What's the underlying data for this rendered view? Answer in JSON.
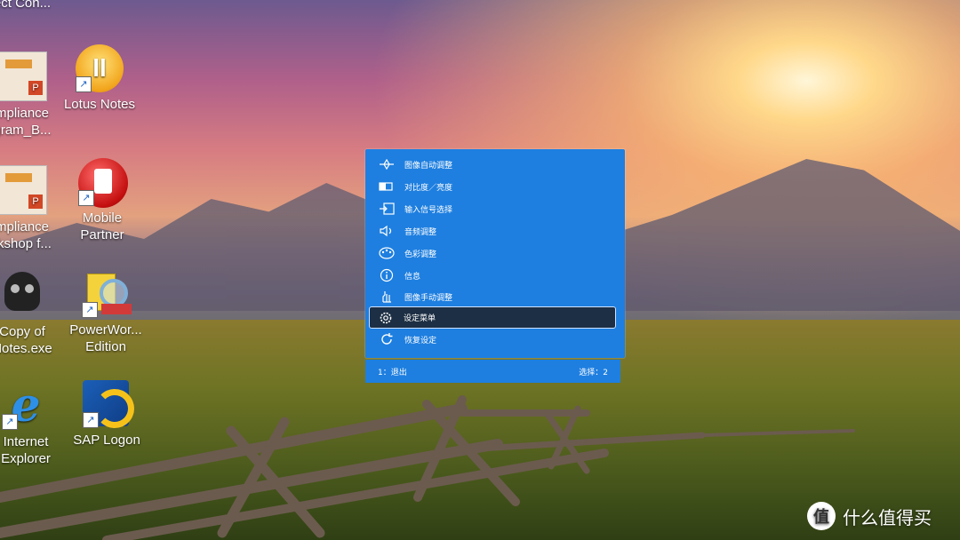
{
  "desktop": {
    "icons": [
      {
        "label": "ect Con...",
        "icon": "remote-desktop-icon"
      },
      {
        "label": "mpliance\ngram_B...",
        "icon": "powerpoint-file-icon"
      },
      {
        "label": "Lotus Notes",
        "icon": "lotus-notes-icon"
      },
      {
        "label": "mpliance\nrkshop f...",
        "icon": "powerpoint-file-icon"
      },
      {
        "label": "Mobile\nPartner",
        "icon": "mobile-partner-icon"
      },
      {
        "label": "Copy of\nNotes.exe",
        "icon": "skull-icon"
      },
      {
        "label": "PowerWor...\nEdition",
        "icon": "powerword-icon"
      },
      {
        "label": "Internet\nExplorer",
        "icon": "internet-explorer-icon"
      },
      {
        "label": "SAP Logon",
        "icon": "sap-logon-icon"
      }
    ]
  },
  "osd": {
    "menu": [
      {
        "label": "图像自动调整",
        "icon": "auto-adjust-icon"
      },
      {
        "label": "对比度／亮度",
        "icon": "contrast-brightness-icon"
      },
      {
        "label": "输入信号选择",
        "icon": "input-source-icon"
      },
      {
        "label": "音频调整",
        "icon": "audio-icon"
      },
      {
        "label": "色彩调整",
        "icon": "color-palette-icon"
      },
      {
        "label": "信息",
        "icon": "info-icon"
      },
      {
        "label": "图像手动调整",
        "icon": "manual-adjust-icon"
      },
      {
        "label": "设定菜单",
        "icon": "settings-gear-icon",
        "selected": true
      },
      {
        "label": "恢复设定",
        "icon": "reset-icon"
      }
    ],
    "footer": {
      "left": "1：退出",
      "right": "选择：2"
    },
    "colors": {
      "panel": "#1e7fe0",
      "selected_bg": "#1d2f44"
    }
  },
  "watermark": {
    "badge": "值",
    "text": "什么值得买"
  }
}
